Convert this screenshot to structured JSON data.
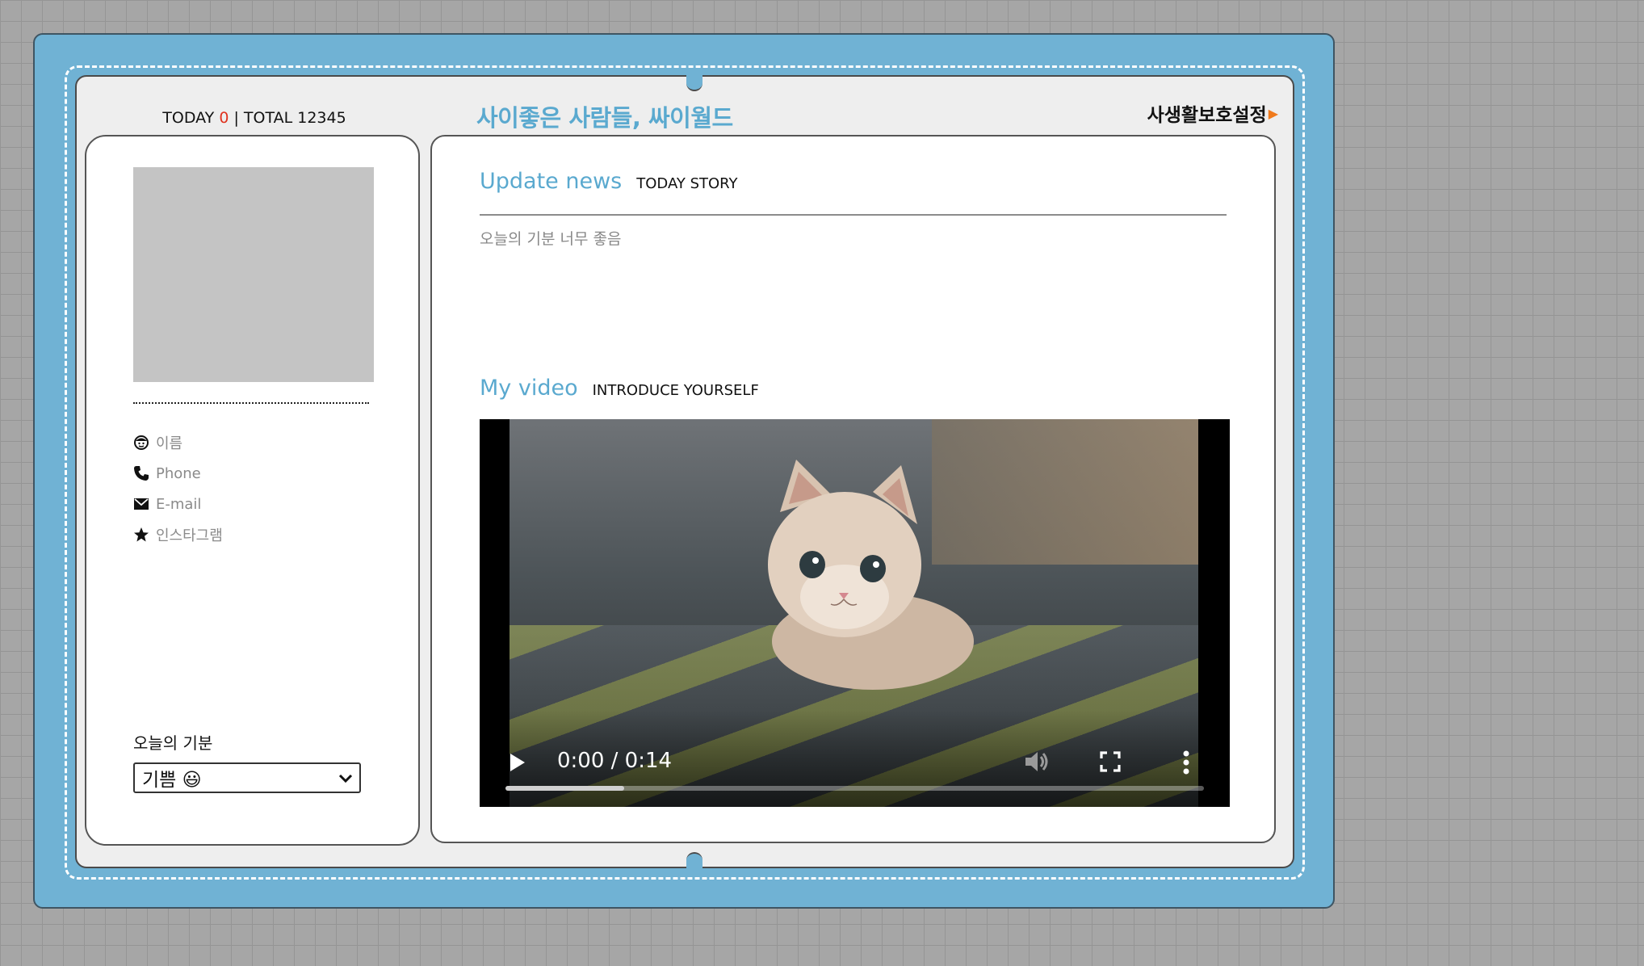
{
  "header": {
    "today_label": "TODAY",
    "today_count": "0",
    "separator": "|",
    "total_label": "TOTAL",
    "total_count": "12345",
    "site_title": "사이좋은 사람들, 싸이월드",
    "privacy_link": "사생활보호설정"
  },
  "profile": {
    "info_items": [
      {
        "icon": "smiley-icon",
        "label": "이름"
      },
      {
        "icon": "phone-icon",
        "label": "Phone"
      },
      {
        "icon": "envelope-icon",
        "label": "E-mail"
      },
      {
        "icon": "star-icon",
        "label": "인스타그램"
      }
    ],
    "mood_label": "오늘의 기분",
    "mood_selected": "기쁨 😃"
  },
  "news": {
    "title": "Update news",
    "subtitle": "TODAY STORY",
    "text": "오늘의 기분 너무 좋음"
  },
  "video": {
    "title": "My video",
    "subtitle": "INTRODUCE YOURSELF",
    "time": "0:00 / 0:14",
    "buffered_fraction": 0.17
  },
  "colors": {
    "frame": "#70b2d4",
    "accent": "#5aa9cf",
    "today_count": "#e0321e",
    "arrow": "#f07a1c"
  }
}
